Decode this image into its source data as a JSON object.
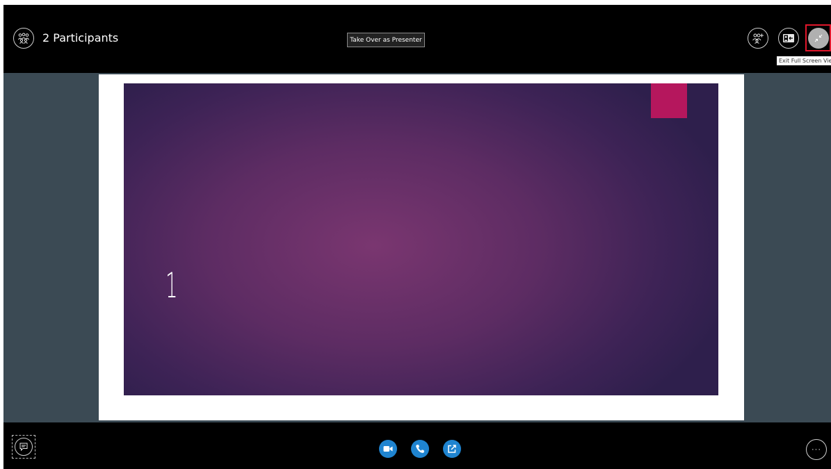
{
  "header": {
    "participants_label": "2 Participants",
    "presenter_button_label": "Take Over as Presenter",
    "exit_tooltip": "Exit Full Screen View"
  },
  "slide": {
    "number": "1",
    "accent_color": "#b5175d",
    "background_color": "#5d2c63"
  },
  "footer": {
    "more_label": "···"
  },
  "icons": {
    "participants": "people-group-icon",
    "add_people": "add-people-icon",
    "layout": "presentation-layout-icon",
    "exit_fullscreen": "exit-fullscreen-icon",
    "chat": "chat-icon",
    "video": "video-camera-icon",
    "call": "phone-icon",
    "share": "share-screen-icon",
    "more": "more-options-icon"
  },
  "colors": {
    "action_blue": "#1f84d0",
    "highlight_red": "#e0162b",
    "stage_background": "#3b4a54"
  }
}
